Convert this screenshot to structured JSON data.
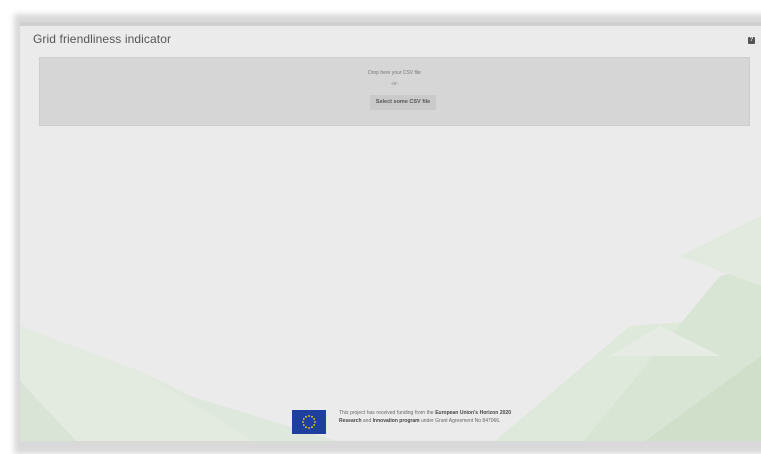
{
  "window": {
    "title": "Grid friendliness indicator",
    "help_icon": "help-icon"
  },
  "dropzone": {
    "drop_text": "Drop here your CSV file",
    "separator": "-or-",
    "select_label": "Select some CSV file"
  },
  "footer": {
    "text_1": "This project has received funding from the",
    "bold_1": "European Union's Horizon 2020 Research",
    "text_2": "and",
    "bold_2": "Innovation program",
    "text_3": "under Grant Agreement No 847066.",
    "flag_icon": "eu-flag-icon"
  },
  "colors": {
    "window_bg": "#ebebeb",
    "dropzone_bg": "#d6d6d6",
    "accent_green": "#d8e6d4",
    "eu_blue": "#1f3f9e",
    "eu_star": "#ffd400"
  }
}
